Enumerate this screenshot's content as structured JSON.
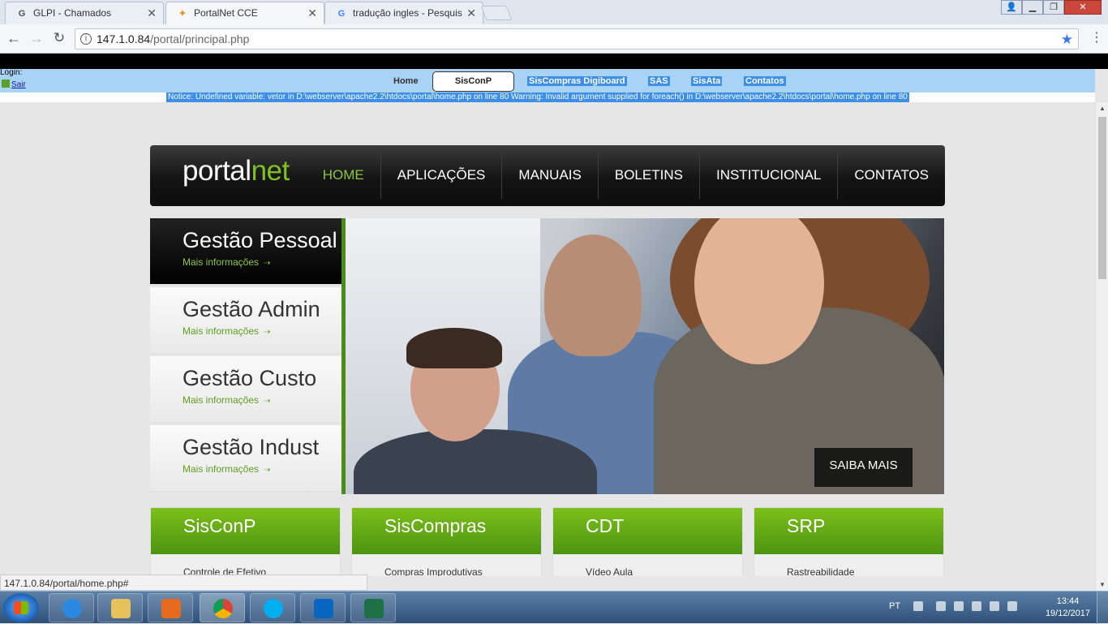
{
  "browser": {
    "tabs": [
      {
        "title": "GLPI - Chamados",
        "icon": "G",
        "active": false
      },
      {
        "title": "PortalNet CCE",
        "icon": "P",
        "active": true
      },
      {
        "title": "tradução ingles - Pesquis",
        "icon": "G",
        "active": false
      }
    ],
    "url_host": "147.1.0.84",
    "url_path": "/portal/principal.php"
  },
  "topnav": {
    "login_label": "Login:",
    "sair": "Sair",
    "items": [
      "Home",
      "SisConP",
      "SisCompras Digiboard",
      "SAS",
      "SisAta",
      "Contatos"
    ]
  },
  "notice": "Notice: Undefined variable: vetor in D:\\webserver\\apache2.2\\htdocs\\portal\\home.php on line 80 Warning: Invalid argument supplied for foreach() in D:\\webserver\\apache2.2\\htdocs\\portal\\home.php on line 80",
  "portal": {
    "logo_part1": "portal",
    "logo_part2": "net",
    "menu": [
      "HOME",
      "APLICAÇÕES",
      "MANUAIS",
      "BOLETINS",
      "INSTITUCIONAL",
      "CONTATOS"
    ],
    "list": [
      {
        "title": "Gestão Pessoal",
        "sub": "Mais informações"
      },
      {
        "title": "Gestão Admin",
        "sub": "Mais informações"
      },
      {
        "title": "Gestão Custo",
        "sub": "Mais informações"
      },
      {
        "title": "Gestão Indust",
        "sub": "Mais informações"
      }
    ],
    "saiba_mais": "SAIBA MAIS",
    "cards": [
      {
        "title": "SisConP",
        "item": "Controle de Efetivo"
      },
      {
        "title": "SisCompras",
        "item": "Compras Improdutivas"
      },
      {
        "title": "CDT",
        "item": "Vídeo Aula"
      },
      {
        "title": "SRP",
        "item": "Rastreabilidade"
      }
    ]
  },
  "status_url": "147.1.0.84/portal/home.php#",
  "taskbar": {
    "lang": "PT",
    "time": "13:44",
    "date": "19/12/2017",
    "apps": [
      "internet-explorer-icon",
      "file-explorer-icon",
      "media-player-icon",
      "chrome-icon",
      "skype-icon",
      "outlook-icon",
      "excel-icon"
    ]
  },
  "colors": {
    "accent_green": "#7fbf24",
    "nav_blue": "#a9d3f5",
    "highlight_blue": "#3d8ee6"
  }
}
